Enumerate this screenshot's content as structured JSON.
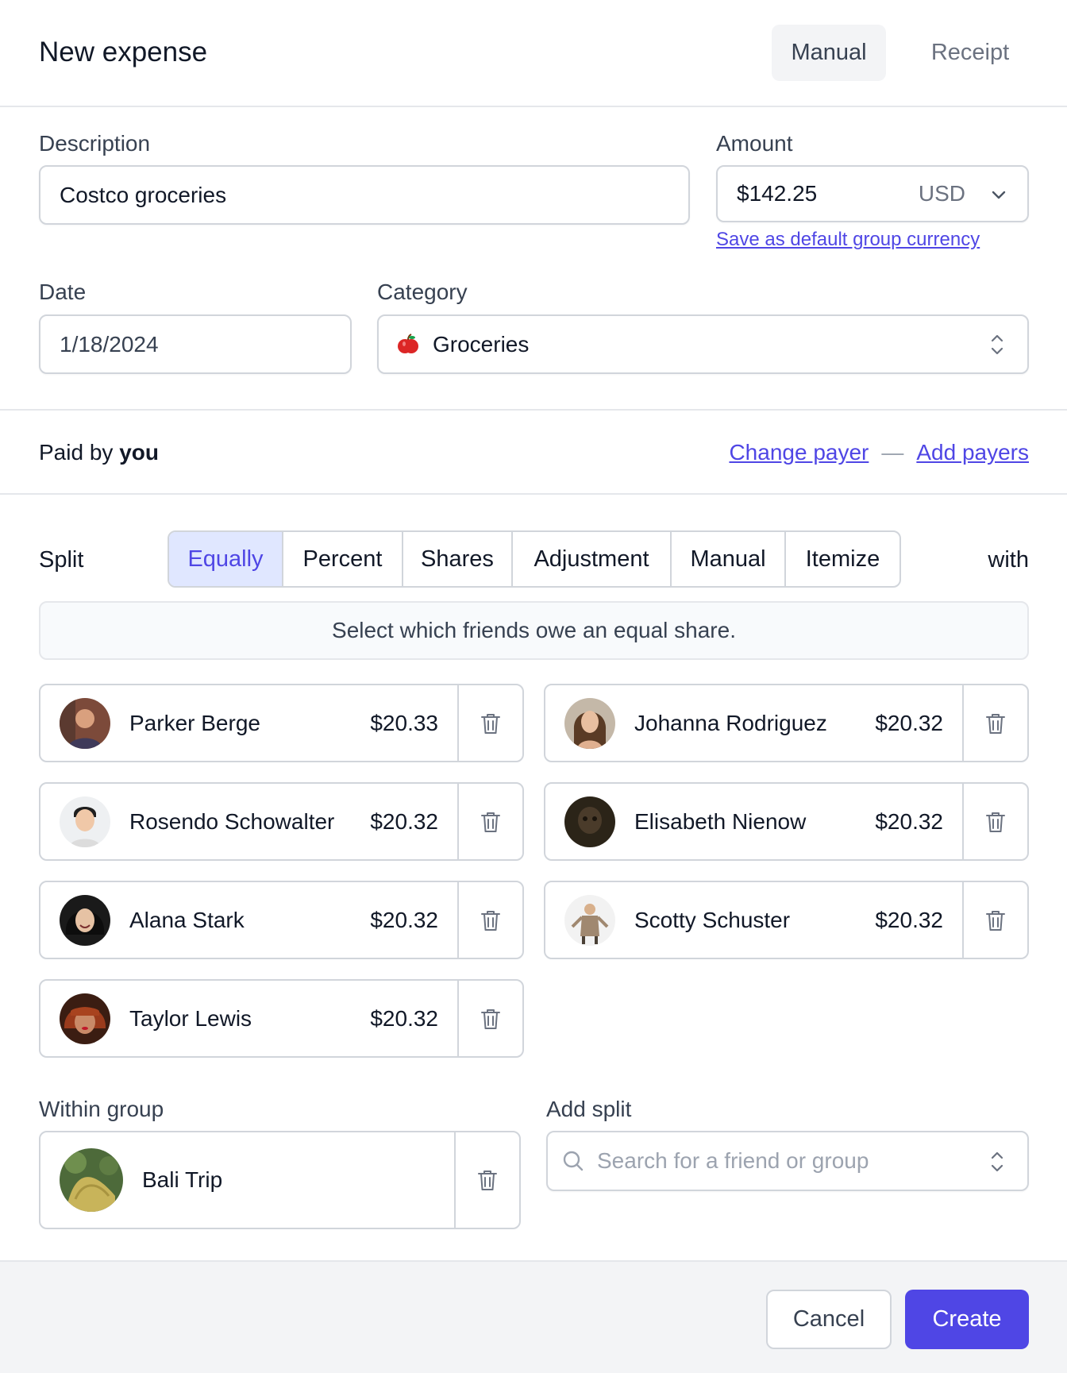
{
  "header": {
    "title": "New expense",
    "tabs": [
      {
        "label": "Manual",
        "active": true
      },
      {
        "label": "Receipt",
        "active": false
      }
    ]
  },
  "description": {
    "label": "Description",
    "value": "Costco groceries"
  },
  "amount": {
    "label": "Amount",
    "value": "$142.25",
    "currency": "USD",
    "default_link": "Save as default group currency"
  },
  "date": {
    "label": "Date",
    "value": "1/18/2024"
  },
  "category": {
    "label": "Category",
    "value": "Groceries",
    "icon": "apple-icon"
  },
  "payer": {
    "prefix": "Paid by",
    "name": "you",
    "change_link": "Change payer",
    "separator": "—",
    "add_link": "Add payers"
  },
  "split": {
    "label": "Split",
    "suffix": "with",
    "options": [
      {
        "label": "Equally",
        "active": true
      },
      {
        "label": "Percent",
        "active": false
      },
      {
        "label": "Shares",
        "active": false
      },
      {
        "label": "Adjustment",
        "active": false
      },
      {
        "label": "Manual",
        "active": false
      },
      {
        "label": "Itemize",
        "active": false
      }
    ],
    "info": "Select which friends owe an equal share.",
    "participants": [
      {
        "name": "Parker Berge",
        "amount": "$20.33"
      },
      {
        "name": "Johanna Rodriguez",
        "amount": "$20.32"
      },
      {
        "name": "Rosendo Schowalter",
        "amount": "$20.32"
      },
      {
        "name": "Elisabeth Nienow",
        "amount": "$20.32"
      },
      {
        "name": "Alana Stark",
        "amount": "$20.32"
      },
      {
        "name": "Scotty Schuster",
        "amount": "$20.32"
      },
      {
        "name": "Taylor Lewis",
        "amount": "$20.32"
      }
    ]
  },
  "group": {
    "label": "Within group",
    "name": "Bali Trip"
  },
  "add_split": {
    "label": "Add split",
    "placeholder": "Search for a friend or group"
  },
  "footer": {
    "cancel": "Cancel",
    "create": "Create"
  },
  "colors": {
    "accent": "#4f46e5",
    "active_bg": "#e0e7ff"
  }
}
